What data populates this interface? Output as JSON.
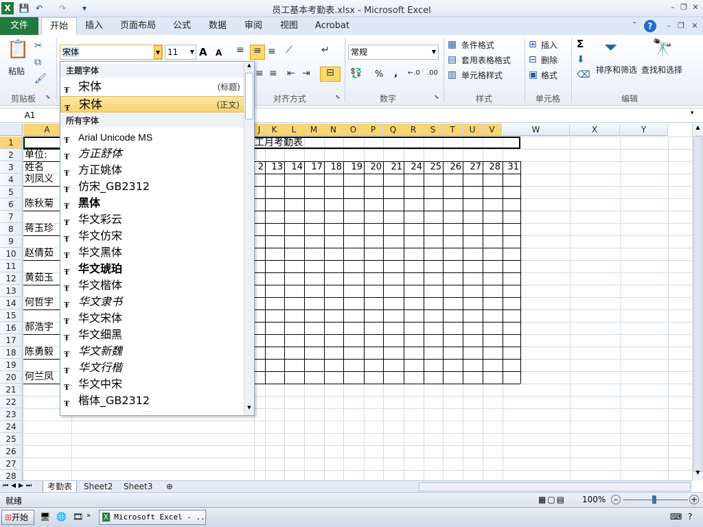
{
  "window": {
    "title": "员工基本考勤表.xlsx - Microsoft Excel",
    "min": "–",
    "restore": "❐",
    "close": "✕",
    "help": "?"
  },
  "qat": {
    "app_icon": "X",
    "save": "💾",
    "undo": "↶",
    "redo": "↷",
    "customize": "▾"
  },
  "tabs": [
    "开始",
    "插入",
    "页面布局",
    "公式",
    "数据",
    "审阅",
    "视图",
    "Acrobat"
  ],
  "file_tab": "文件",
  "ribbon": {
    "clipboard": {
      "paste": "粘贴",
      "label": "剪贴板"
    },
    "font": {
      "name": "宋体",
      "size": "11",
      "grow": "A",
      "shrink": "A"
    },
    "alignment": {
      "label": "对齐方式"
    },
    "number": {
      "format": "常规",
      "percent": "%",
      "comma": ",",
      "label": "数字",
      "inc": "←.0",
      "dec": ".00"
    },
    "styles": {
      "cond": "条件格式",
      "table": "套用表格格式",
      "cell": "单元格样式",
      "label": "样式"
    },
    "cells": {
      "insert": "插入",
      "delete": "删除",
      "format": "格式",
      "label": "单元格"
    },
    "editing": {
      "sum": "Σ",
      "sort": "排序和筛选",
      "find": "查找和选择",
      "label": "编辑"
    }
  },
  "formula_bar": {
    "namebox": "A1",
    "value": ""
  },
  "columns": [
    "A",
    "J",
    "K",
    "L",
    "M",
    "N",
    "O",
    "P",
    "Q",
    "R",
    "S",
    "T",
    "U",
    "V",
    "W",
    "X",
    "Y"
  ],
  "row_numbers": [
    "1",
    "2",
    "3",
    "4",
    "5",
    "6",
    "7",
    "8",
    "9",
    "10",
    "11",
    "12",
    "13",
    "14",
    "15",
    "16",
    "17",
    "18",
    "19",
    "20",
    "21",
    "22",
    "23",
    "24",
    "25",
    "26",
    "27",
    "28"
  ],
  "cells": {
    "title_fragment": "工月考勤表",
    "unit": "单位:",
    "name_header": "姓名",
    "employees": [
      "刘凤义",
      "陈秋菊",
      "蒋玉珍",
      "赵倩茹",
      "黄茹玉",
      "何哲宇",
      "郝浩宇",
      "陈勇毅",
      "何兰凤"
    ],
    "days": [
      "2",
      "13",
      "14",
      "17",
      "18",
      "19",
      "20",
      "21",
      "24",
      "25",
      "26",
      "27",
      "28",
      "31"
    ]
  },
  "font_dropdown": {
    "theme_label": "主题字体",
    "theme": [
      {
        "name": "宋体",
        "tag": "(标题)"
      },
      {
        "name": "宋体",
        "tag": "(正文)"
      }
    ],
    "all_label": "所有字体",
    "fonts": [
      "Arial Unicode MS",
      "方正舒体",
      "方正姚体",
      "仿宋_GB2312",
      "黑体",
      "华文彩云",
      "华文仿宋",
      "华文黑体",
      "华文琥珀",
      "华文楷体",
      "华文隶书",
      "华文宋体",
      "华文细黑",
      "华文新魏",
      "华文行楷",
      "华文中宋",
      "楷体_GB2312"
    ],
    "resize": "····"
  },
  "sheets": [
    "考勤表",
    "Sheet2",
    "Sheet3"
  ],
  "status": {
    "ready": "就绪",
    "zoom": "100%",
    "zoom_minus": "–",
    "zoom_plus": "+"
  },
  "taskbar": {
    "start": "开始",
    "task": "Microsoft Excel - ..."
  },
  "colors": {
    "accent": "#217a3b",
    "highlight": "#f9d36a"
  }
}
